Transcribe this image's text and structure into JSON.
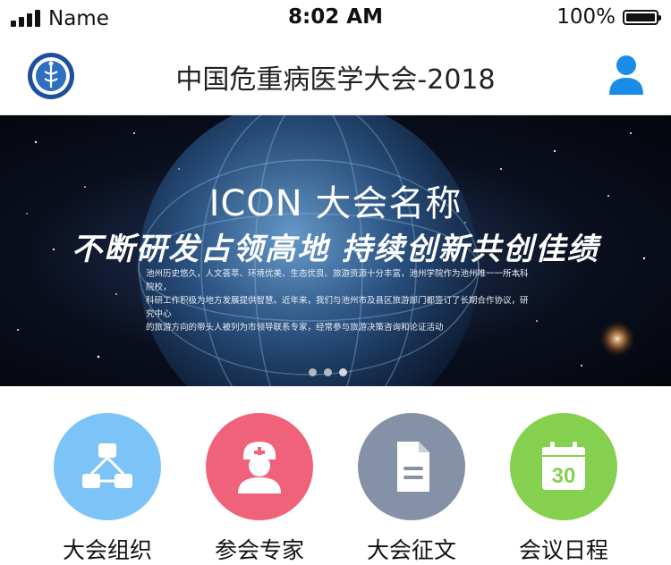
{
  "status_bar": {
    "carrier": "Name",
    "time": "8:02 AM",
    "battery": "100%",
    "battery_level": 1.0,
    "icons": [
      "signal-icon",
      "battery-icon"
    ]
  },
  "header": {
    "title": "中国危重病医学大会-2018",
    "logo_icon": "conference-logo-icon",
    "user_icon": "user-icon",
    "accent": "#1a8ce8"
  },
  "banner": {
    "title": "ICON 大会名称",
    "slogan": "不断研发占领高地   持续创新共创佳绩",
    "description_lines": [
      "池州历史悠久，人文荟萃、环境优美、生态优良、旅游资源十分丰富，池州学院作为池州唯一一所本科院校，",
      "科研工作积极为地方发展提供智慧。近年来，我们与池州市及县区旅游部门都签订了长期合作协议，研究中心",
      "的旅游方向的带头人被列为市领导联系专家，经常参与旅游决策咨询和论证活动"
    ],
    "carousel_total": 3,
    "carousel_active": 3
  },
  "menu": {
    "items": [
      {
        "label": "大会组织",
        "icon": "organization-icon",
        "color": "#7cc3f7"
      },
      {
        "label": "参会专家",
        "icon": "doctor-icon",
        "color": "#f0627a"
      },
      {
        "label": "大会征文",
        "icon": "document-icon",
        "color": "#8591a6"
      },
      {
        "label": "会议日程",
        "icon": "calendar-icon",
        "color": "#86d04f",
        "calendar_day": "30"
      }
    ]
  }
}
